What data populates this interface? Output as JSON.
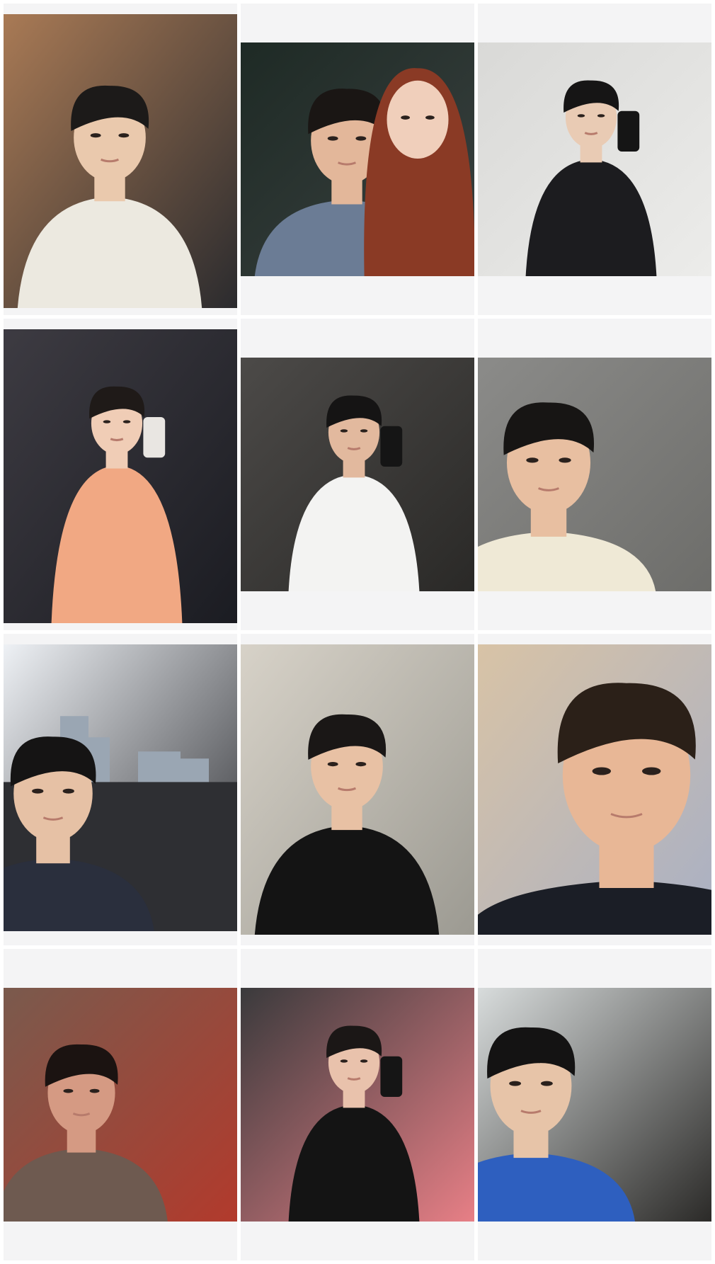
{
  "gallery": {
    "background": "#ffffff",
    "cell_background": "#f4f4f5",
    "photos": [
      {
        "kind": "selfie",
        "bg": "#a97a55",
        "bg2": "#2b2b2e",
        "skin": "#eac9ad",
        "hair": "#1c1a19",
        "shirt": "#ece9e0",
        "accent": "#3f8a4c"
      },
      {
        "kind": "two-person-selfie",
        "bg": "#1e2a25",
        "bg2": "#3a4140",
        "skin": "#e3b79a",
        "hair": "#1a1614",
        "shirt": "#6b7c95",
        "accent": "#8a3a25"
      },
      {
        "kind": "mirror-selfie",
        "bg": "#d9d9d7",
        "bg2": "#ececea",
        "skin": "#e9cbb4",
        "hair": "#161515",
        "shirt": "#1c1c1f",
        "accent": "#2b2b2e"
      },
      {
        "kind": "mirror-selfie",
        "bg": "#3d3b42",
        "bg2": "#1b1c22",
        "skin": "#f0cdb6",
        "hair": "#1f1a18",
        "shirt": "#f1a883",
        "accent": "#e9e6e2"
      },
      {
        "kind": "elevator-mirror-selfie",
        "bg": "#4c4a48",
        "bg2": "#2a2927",
        "skin": "#e2b99e",
        "hair": "#151414",
        "shirt": "#f3f3f2",
        "accent": "#111111"
      },
      {
        "kind": "selfie",
        "bg": "#8b8b89",
        "bg2": "#6d6d6a",
        "skin": "#e8bfa1",
        "hair": "#171514",
        "shirt": "#efe9d6",
        "accent": "#cfc9b4"
      },
      {
        "kind": "outdoor-selfie",
        "bg": "#eef1f5",
        "bg2": "#2e2f33",
        "skin": "#e6c1a5",
        "hair": "#151414",
        "shirt": "#2a2f3d",
        "accent": "#ffffff"
      },
      {
        "kind": "selfie",
        "bg": "#d7d2c8",
        "bg2": "#9c9a92",
        "skin": "#e8c1a4",
        "hair": "#1a1716",
        "shirt": "#141414",
        "accent": "#706a60"
      },
      {
        "kind": "close-selfie",
        "bg": "#d8c3a6",
        "bg2": "#a9b0c4",
        "skin": "#e8b796",
        "hair": "#2b2018",
        "shirt": "#1b1e26",
        "accent": "#c9cfdb"
      },
      {
        "kind": "selfie",
        "bg": "#7a5a4d",
        "bg2": "#b23a2c",
        "skin": "#d59a83",
        "hair": "#1b1311",
        "shirt": "#6e5a50",
        "accent": "#8fb8d6"
      },
      {
        "kind": "mirror-selfie",
        "bg": "#3a3a3c",
        "bg2": "#e77f86",
        "skin": "#e9c2ac",
        "hair": "#1b1716",
        "shirt": "#141414",
        "accent": "#2fb5a8"
      },
      {
        "kind": "selfie",
        "bg": "#d8dcdc",
        "bg2": "#2b2a28",
        "skin": "#e7c4a8",
        "hair": "#141313",
        "shirt": "#2e5fbf",
        "accent": "#c9a266"
      }
    ]
  }
}
